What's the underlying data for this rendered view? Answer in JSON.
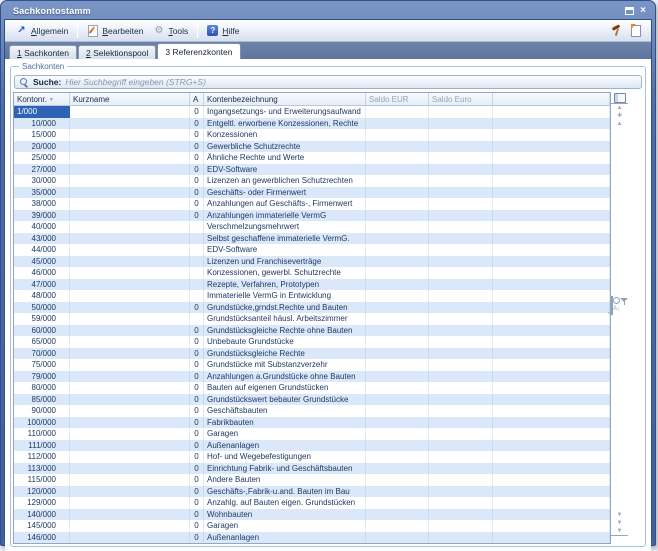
{
  "window": {
    "title": "Sachkontostamm"
  },
  "toolbar": {
    "buttons": [
      {
        "label": "Allgemein",
        "underline_index": 0,
        "icon": "arrow-ne-icon",
        "separator_after": true
      },
      {
        "label": "Bearbeiten",
        "underline_index": 0,
        "icon": "edit-icon",
        "separator_after": false
      },
      {
        "label": "Tools",
        "underline_index": 0,
        "icon": "tools-icon",
        "separator_after": true
      },
      {
        "label": "Hilfe",
        "underline_index": 0,
        "icon": "help-icon",
        "separator_after": false
      }
    ],
    "right_icons": [
      {
        "name": "hammer-icon"
      },
      {
        "name": "new-document-icon"
      }
    ]
  },
  "tabs": [
    {
      "label": "1 Sachkonten",
      "underline_index": 0,
      "active": false
    },
    {
      "label": "2 Selektionspool",
      "underline_index": 0,
      "active": false
    },
    {
      "label": "3 Referenzkonten",
      "underline_index": -1,
      "active": true
    }
  ],
  "panel": {
    "fieldset_label": "Sachkonten"
  },
  "search": {
    "label": "Suche:",
    "placeholder": "Hier Suchbegriff eingeben (STRG+S)"
  },
  "grid": {
    "columns": [
      {
        "label": "Kontonr.",
        "sort": "desc",
        "muted": false
      },
      {
        "label": "Kurzname",
        "sort": "",
        "muted": false
      },
      {
        "label": "A",
        "sort": "",
        "muted": false
      },
      {
        "label": "Kontenbezeichnung",
        "sort": "",
        "muted": false
      },
      {
        "label": "Saldo EUR",
        "sort": "",
        "muted": true
      },
      {
        "label": "Saldo Euro",
        "sort": "",
        "muted": true
      },
      {
        "label": "",
        "sort": "",
        "muted": false
      }
    ],
    "rows": [
      {
        "kontonr": "1/000",
        "kurzname": "",
        "a": "0",
        "bezeichnung": "Ingangsetzungs- und Erweiterungsaufwand",
        "saldo_eur": "",
        "saldo_euro": "",
        "selected": true
      },
      {
        "kontonr": "10/000",
        "kurzname": "",
        "a": "0",
        "bezeichnung": "Entgeltl. erworbene Konzessionen, Rechte",
        "saldo_eur": "",
        "saldo_euro": ""
      },
      {
        "kontonr": "15/000",
        "kurzname": "",
        "a": "0",
        "bezeichnung": "Konzessionen",
        "saldo_eur": "",
        "saldo_euro": ""
      },
      {
        "kontonr": "20/000",
        "kurzname": "",
        "a": "0",
        "bezeichnung": "Gewerbliche Schutzrechte",
        "saldo_eur": "",
        "saldo_euro": ""
      },
      {
        "kontonr": "25/000",
        "kurzname": "",
        "a": "0",
        "bezeichnung": "Ähnliche Rechte und Werte",
        "saldo_eur": "",
        "saldo_euro": ""
      },
      {
        "kontonr": "27/000",
        "kurzname": "",
        "a": "0",
        "bezeichnung": "EDV-Software",
        "saldo_eur": "",
        "saldo_euro": ""
      },
      {
        "kontonr": "30/000",
        "kurzname": "",
        "a": "0",
        "bezeichnung": "Lizenzen an gewerblichen Schutzrechten",
        "saldo_eur": "",
        "saldo_euro": ""
      },
      {
        "kontonr": "35/000",
        "kurzname": "",
        "a": "0",
        "bezeichnung": "Geschäfts- oder Firmenwert",
        "saldo_eur": "",
        "saldo_euro": ""
      },
      {
        "kontonr": "38/000",
        "kurzname": "",
        "a": "0",
        "bezeichnung": "Anzahlungen auf Geschäfts-, Firmenwert",
        "saldo_eur": "",
        "saldo_euro": ""
      },
      {
        "kontonr": "39/000",
        "kurzname": "",
        "a": "0",
        "bezeichnung": "Anzahlungen immaterielle VermG",
        "saldo_eur": "",
        "saldo_euro": ""
      },
      {
        "kontonr": "40/000",
        "kurzname": "",
        "a": "",
        "bezeichnung": "Verschmelzungsmehrwert",
        "saldo_eur": "",
        "saldo_euro": ""
      },
      {
        "kontonr": "43/000",
        "kurzname": "",
        "a": "",
        "bezeichnung": "Selbst geschaffene immaterielle VermG.",
        "saldo_eur": "",
        "saldo_euro": ""
      },
      {
        "kontonr": "44/000",
        "kurzname": "",
        "a": "",
        "bezeichnung": "EDV-Software",
        "saldo_eur": "",
        "saldo_euro": ""
      },
      {
        "kontonr": "45/000",
        "kurzname": "",
        "a": "",
        "bezeichnung": "Lizenzen und Franchiseverträge",
        "saldo_eur": "",
        "saldo_euro": ""
      },
      {
        "kontonr": "46/000",
        "kurzname": "",
        "a": "",
        "bezeichnung": "Konzessionen, gewerbl. Schutzrechte",
        "saldo_eur": "",
        "saldo_euro": ""
      },
      {
        "kontonr": "47/000",
        "kurzname": "",
        "a": "",
        "bezeichnung": "Rezepte, Verfahren, Prototypen",
        "saldo_eur": "",
        "saldo_euro": ""
      },
      {
        "kontonr": "48/000",
        "kurzname": "",
        "a": "",
        "bezeichnung": "Immaterielle VermG in Entwicklung",
        "saldo_eur": "",
        "saldo_euro": ""
      },
      {
        "kontonr": "50/000",
        "kurzname": "",
        "a": "0",
        "bezeichnung": "Grundstücke,grndst.Rechte und Bauten",
        "saldo_eur": "",
        "saldo_euro": ""
      },
      {
        "kontonr": "59/000",
        "kurzname": "",
        "a": "",
        "bezeichnung": "Grundstücksanteil häusl. Arbeitszimmer",
        "saldo_eur": "",
        "saldo_euro": ""
      },
      {
        "kontonr": "60/000",
        "kurzname": "",
        "a": "0",
        "bezeichnung": "Grundstücksgleiche Rechte ohne Bauten",
        "saldo_eur": "",
        "saldo_euro": ""
      },
      {
        "kontonr": "65/000",
        "kurzname": "",
        "a": "0",
        "bezeichnung": "Unbebaute Grundstücke",
        "saldo_eur": "",
        "saldo_euro": ""
      },
      {
        "kontonr": "70/000",
        "kurzname": "",
        "a": "0",
        "bezeichnung": "Grundstücksgleiche Rechte",
        "saldo_eur": "",
        "saldo_euro": ""
      },
      {
        "kontonr": "75/000",
        "kurzname": "",
        "a": "0",
        "bezeichnung": "Grundstücke mit Substanzverzehr",
        "saldo_eur": "",
        "saldo_euro": ""
      },
      {
        "kontonr": "79/000",
        "kurzname": "",
        "a": "0",
        "bezeichnung": "Anzahlungen a.Grundstücke ohne Bauten",
        "saldo_eur": "",
        "saldo_euro": ""
      },
      {
        "kontonr": "80/000",
        "kurzname": "",
        "a": "0",
        "bezeichnung": "Bauten auf eigenen Grundstücken",
        "saldo_eur": "",
        "saldo_euro": ""
      },
      {
        "kontonr": "85/000",
        "kurzname": "",
        "a": "0",
        "bezeichnung": "Grundstückswert bebauter Grundstücke",
        "saldo_eur": "",
        "saldo_euro": ""
      },
      {
        "kontonr": "90/000",
        "kurzname": "",
        "a": "0",
        "bezeichnung": "Geschäftsbauten",
        "saldo_eur": "",
        "saldo_euro": ""
      },
      {
        "kontonr": "100/000",
        "kurzname": "",
        "a": "0",
        "bezeichnung": "Fabrikbauten",
        "saldo_eur": "",
        "saldo_euro": ""
      },
      {
        "kontonr": "110/000",
        "kurzname": "",
        "a": "0",
        "bezeichnung": "Garagen",
        "saldo_eur": "",
        "saldo_euro": ""
      },
      {
        "kontonr": "111/000",
        "kurzname": "",
        "a": "0",
        "bezeichnung": "Außenanlagen",
        "saldo_eur": "",
        "saldo_euro": ""
      },
      {
        "kontonr": "112/000",
        "kurzname": "",
        "a": "0",
        "bezeichnung": "Hof- und Wegebefestigungen",
        "saldo_eur": "",
        "saldo_euro": ""
      },
      {
        "kontonr": "113/000",
        "kurzname": "",
        "a": "0",
        "bezeichnung": "Einrichtung Fabrik- und Geschäftsbauten",
        "saldo_eur": "",
        "saldo_euro": ""
      },
      {
        "kontonr": "115/000",
        "kurzname": "",
        "a": "0",
        "bezeichnung": "Andere Bauten",
        "saldo_eur": "",
        "saldo_euro": ""
      },
      {
        "kontonr": "120/000",
        "kurzname": "",
        "a": "0",
        "bezeichnung": "Geschäfts-,Fabrik-u.and. Bauten im Bau",
        "saldo_eur": "",
        "saldo_euro": ""
      },
      {
        "kontonr": "129/000",
        "kurzname": "",
        "a": "0",
        "bezeichnung": "Anzahlg. auf Bauten eigen. Grundstücken",
        "saldo_eur": "",
        "saldo_euro": ""
      },
      {
        "kontonr": "140/000",
        "kurzname": "",
        "a": "0",
        "bezeichnung": "Wohnbauten",
        "saldo_eur": "",
        "saldo_euro": ""
      },
      {
        "kontonr": "145/000",
        "kurzname": "",
        "a": "0",
        "bezeichnung": "Garagen",
        "saldo_eur": "",
        "saldo_euro": ""
      },
      {
        "kontonr": "146/000",
        "kurzname": "",
        "a": "0",
        "bezeichnung": "Außenanlagen",
        "saldo_eur": "",
        "saldo_euro": ""
      }
    ]
  },
  "side_toolbar": {
    "top_icon": {
      "name": "column-chooser-icon"
    },
    "scroll_up_group": [
      {
        "name": "scroll-top-icon"
      },
      {
        "name": "scroll-up-icon"
      },
      {
        "name": "scroll-up-page-icon"
      }
    ],
    "middle_group": [
      {
        "name": "table-view-icon"
      },
      {
        "name": "search-icon"
      },
      {
        "name": "sort-icon"
      },
      {
        "name": "filter-icon"
      }
    ],
    "scroll_down_group": [
      {
        "name": "scroll-down-icon"
      },
      {
        "name": "scroll-down-page-icon"
      },
      {
        "name": "scroll-bottom-icon"
      }
    ]
  },
  "colors": {
    "titlebar": "#4e6ca8",
    "frame": "#41609e",
    "selection": "#2f63b5",
    "row_alt": "#dbe8f9",
    "tabstrip": "#5d76a0"
  }
}
